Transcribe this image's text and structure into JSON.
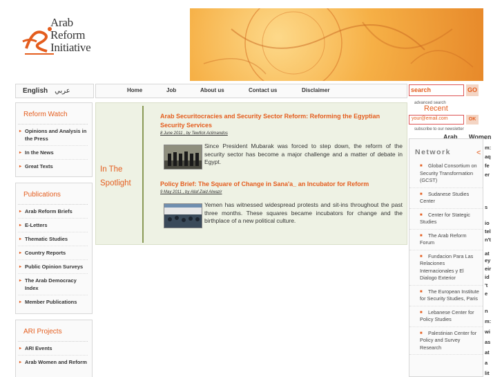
{
  "logo": {
    "line1": "Arab",
    "line2": "Reform",
    "line3": "Initiative",
    "accent": "#e45d1e"
  },
  "lang": {
    "english": "English",
    "arabic": "عربي"
  },
  "nav": [
    "Home",
    "Job",
    "About us",
    "Contact us",
    "Disclaimer"
  ],
  "search": {
    "value": "search",
    "go": "GO",
    "advanced": "advanced search"
  },
  "recent": "Recent",
  "newsletter": {
    "email_value": "your@email.com",
    "ok": "OK",
    "subscribe": "subscribe to our newsletter"
  },
  "right_tabs": {
    "tab1": "Arab",
    "tab2": "Women"
  },
  "sidebar": [
    {
      "title": "Reform Watch",
      "items": [
        "Opinions and Analysis in the Press",
        "In the News",
        "Great Texts"
      ]
    },
    {
      "title": "Publications",
      "items": [
        "Arab Reform Briefs",
        "E-Letters",
        "Thematic Studies",
        "Country Reports",
        "Public Opinion Surveys",
        "The Arab Democracy Index",
        "Member Publications"
      ]
    },
    {
      "title": "ARI Projects",
      "items": [
        "ARI Events",
        "Arab Women and Reform"
      ]
    }
  ],
  "spotlight": {
    "title": "In The Spotlight",
    "articles": [
      {
        "title": "Arab Securitocracies and Security Sector Reform: Reforming the Egyptian Security Services",
        "meta": "8 June 2011 , by Tewfick Aclimandos",
        "excerpt": "Since President Mubarak was forced to step down, the reform of the security sector has become a major challenge and a matter of debate in Egypt."
      },
      {
        "title": "Policy Brief: The Square of Change in Sana'a_ an Incubator for Reform",
        "meta": "9 May 2011 , by Allaf Zaid Alwazir",
        "excerpt": "Yemen has witnessed widespread protests and sit-ins throughout the past three months. These squares became incubators for change and the birthplace of a new political culture."
      }
    ]
  },
  "network": {
    "title": "Network",
    "items": [
      "Global Consortium on Security Transformation (GCST)",
      "Sudanese Studies Center",
      "Center for Stategic Studies",
      "The Arab Reform Forum",
      "Fundacion Para Las Relaciones Internacionales y El Dialogo Exterior",
      "The European Institute for Security Studies, Paris",
      "Lebanese Center for Policy Studies",
      "Palestinian Center for Policy and Survey Research"
    ]
  },
  "clipped_text": [
    "m:",
    "aq",
    "fe",
    "er",
    "s",
    "io",
    "tel",
    "n't",
    "at",
    "ey",
    "eir",
    "id",
    "'t",
    "e",
    "n",
    "m:",
    "wi",
    "as",
    "at",
    "a",
    "lit"
  ]
}
